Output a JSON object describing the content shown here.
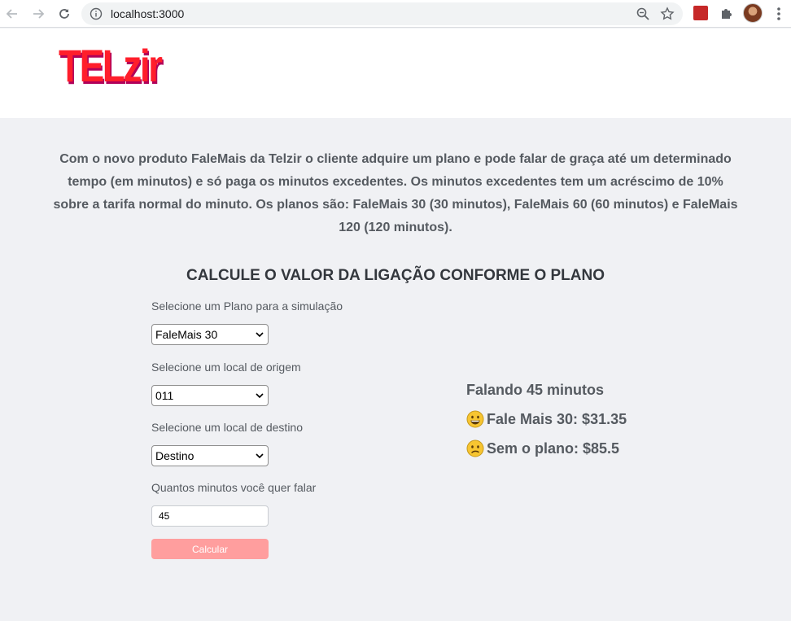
{
  "browser": {
    "url": "localhost:3000"
  },
  "header": {
    "logo_text": "TELzir"
  },
  "intro": {
    "text": "Com o novo produto FaleMais da Telzir o cliente adquire um plano e pode falar de graça até um determinado tempo (em minutos) e só paga os minutos excedentes. Os minutos excedentes tem um acréscimo de 10% sobre a tarifa normal do minuto. Os planos são: FaleMais 30 (30 minutos), FaleMais 60 (60 minutos) e FaleMais 120 (120 minutos)."
  },
  "calculator": {
    "title": "CALCULE O VALOR DA LIGAÇÃO CONFORME O PLANO",
    "plan_label": "Selecione um Plano para a simulação",
    "plan_value": "FaleMais 30",
    "origin_label": "Selecione um local de origem",
    "origin_value": "011",
    "destination_label": "Selecione um local de destino",
    "destination_value": "Destino",
    "minutes_label": "Quantos minutos você quer falar",
    "minutes_value": "45",
    "button_label": "Calcular"
  },
  "results": {
    "talking": "Falando 45 minutos",
    "with_plan": "Fale Mais 30: $31.35",
    "without_plan": "Sem o plano: $85.5"
  },
  "colors": {
    "logo": "#ff1e2b",
    "button": "#ff9e9e",
    "background": "#f0f1f4"
  },
  "icons": {
    "with_plan_emoji": "grinning-face-icon",
    "without_plan_emoji": "confused-face-icon"
  }
}
